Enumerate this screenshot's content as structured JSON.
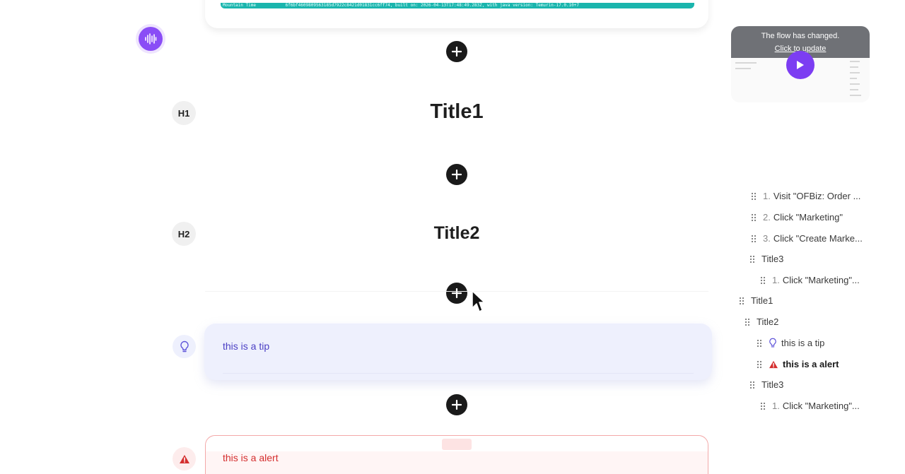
{
  "screenshot_strip": {
    "part1": "Mountain Time",
    "part2": "6f6bf4609809563185d7922c8421d01831cc6ff74, built on: 2026-04-13T17:48:49.283Z, with java version: Temurin-17.0.10+7"
  },
  "voice": {
    "icon": "audio-waveform-icon",
    "color": "#8a4df6"
  },
  "blocks": {
    "h1_badge": "H1",
    "title1": "Title1",
    "h2_badge": "H2",
    "title2": "Title2",
    "tip_text": "this is a tip",
    "alert_text": "this is a alert"
  },
  "update_banner": {
    "message": "The flow has changed.",
    "link": "Click to update"
  },
  "outline": [
    {
      "num": "1.",
      "label": "Visit \"OFBiz: Order ...",
      "icon": ""
    },
    {
      "num": "2.",
      "label": "Click \"Marketing\"",
      "icon": ""
    },
    {
      "num": "3.",
      "label": "Click \"Create Marke...",
      "icon": ""
    },
    {
      "num": "",
      "label": "Title3",
      "icon": ""
    },
    {
      "num": "1.",
      "label": "Click \"Marketing\"...",
      "icon": ""
    },
    {
      "num": "",
      "label": "Title1",
      "icon": ""
    },
    {
      "num": "",
      "label": "Title2",
      "icon": ""
    },
    {
      "num": "",
      "label": "this is a tip",
      "icon": "lightbulb-icon"
    },
    {
      "num": "",
      "label": "this is a alert",
      "icon": "warning-icon",
      "active": true
    },
    {
      "num": "",
      "label": "Title3",
      "icon": ""
    },
    {
      "num": "1.",
      "label": "Click \"Marketing\"...",
      "icon": ""
    }
  ],
  "colors": {
    "accent_purple": "#7c3df2",
    "tip_text": "#4b3fc4",
    "alert_red": "#d42e2e",
    "teal_strip": "#1ab5ad"
  }
}
